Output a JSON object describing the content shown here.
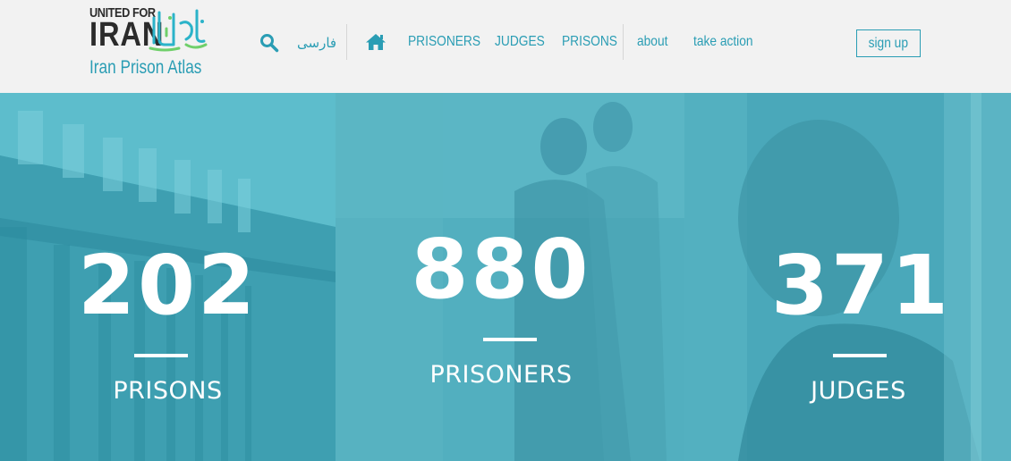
{
  "logo": {
    "line1": "UNITED FOR",
    "line2": "IRAN",
    "arabic": "اتحاد برای ایران",
    "subtitle": "Iran Prison Atlas"
  },
  "nav": {
    "search_icon": "search-icon",
    "farsi": "فارسی",
    "home_icon": "home-icon",
    "links": [
      "PRISONERS",
      "JUDGES",
      "PRISONS",
      "about",
      "take action"
    ],
    "signup": "sign up"
  },
  "stats": [
    {
      "number": "202",
      "label": "PRISONS"
    },
    {
      "number": "880",
      "label": "PRISONERS"
    },
    {
      "number": "371",
      "label": "JUDGES"
    }
  ],
  "colors": {
    "accent": "#2a9db4",
    "header_bg": "#f2f2f2",
    "overlay": "#3aa3b3"
  }
}
